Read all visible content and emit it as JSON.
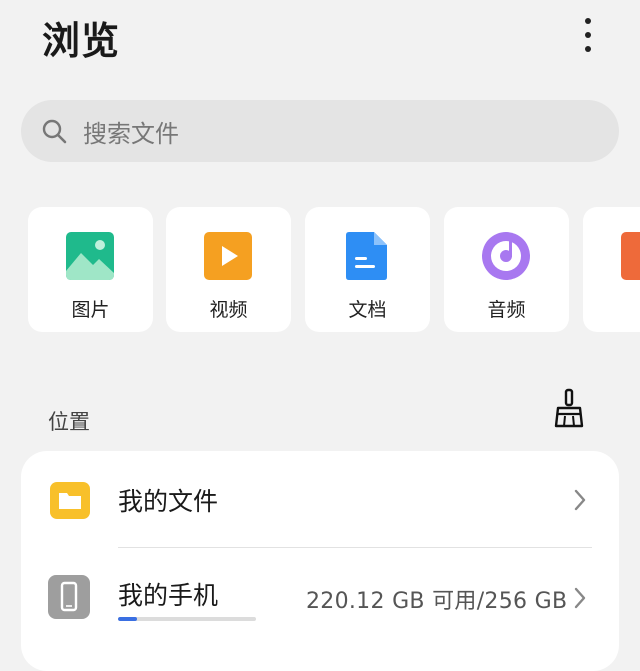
{
  "header": {
    "title": "浏览"
  },
  "search": {
    "placeholder": "搜索文件"
  },
  "categories": [
    {
      "label": "图片",
      "icon": "image-icon",
      "color": "#1fba8c"
    },
    {
      "label": "视频",
      "icon": "video-icon",
      "color": "#f5a021"
    },
    {
      "label": "文档",
      "icon": "document-icon",
      "color": "#2e8ef4"
    },
    {
      "label": "音频",
      "icon": "audio-icon",
      "color": "#a878f0"
    },
    {
      "label": "",
      "icon": "partial-card-icon",
      "color": "#ee6a3a"
    }
  ],
  "locations": {
    "title": "位置",
    "items": [
      {
        "label": "我的文件",
        "icon": "folder-icon"
      },
      {
        "label": "我的手机",
        "icon": "phone-icon",
        "usage": "220.12 GB 可用/256 GB",
        "used_fraction": 0.14
      }
    ]
  }
}
